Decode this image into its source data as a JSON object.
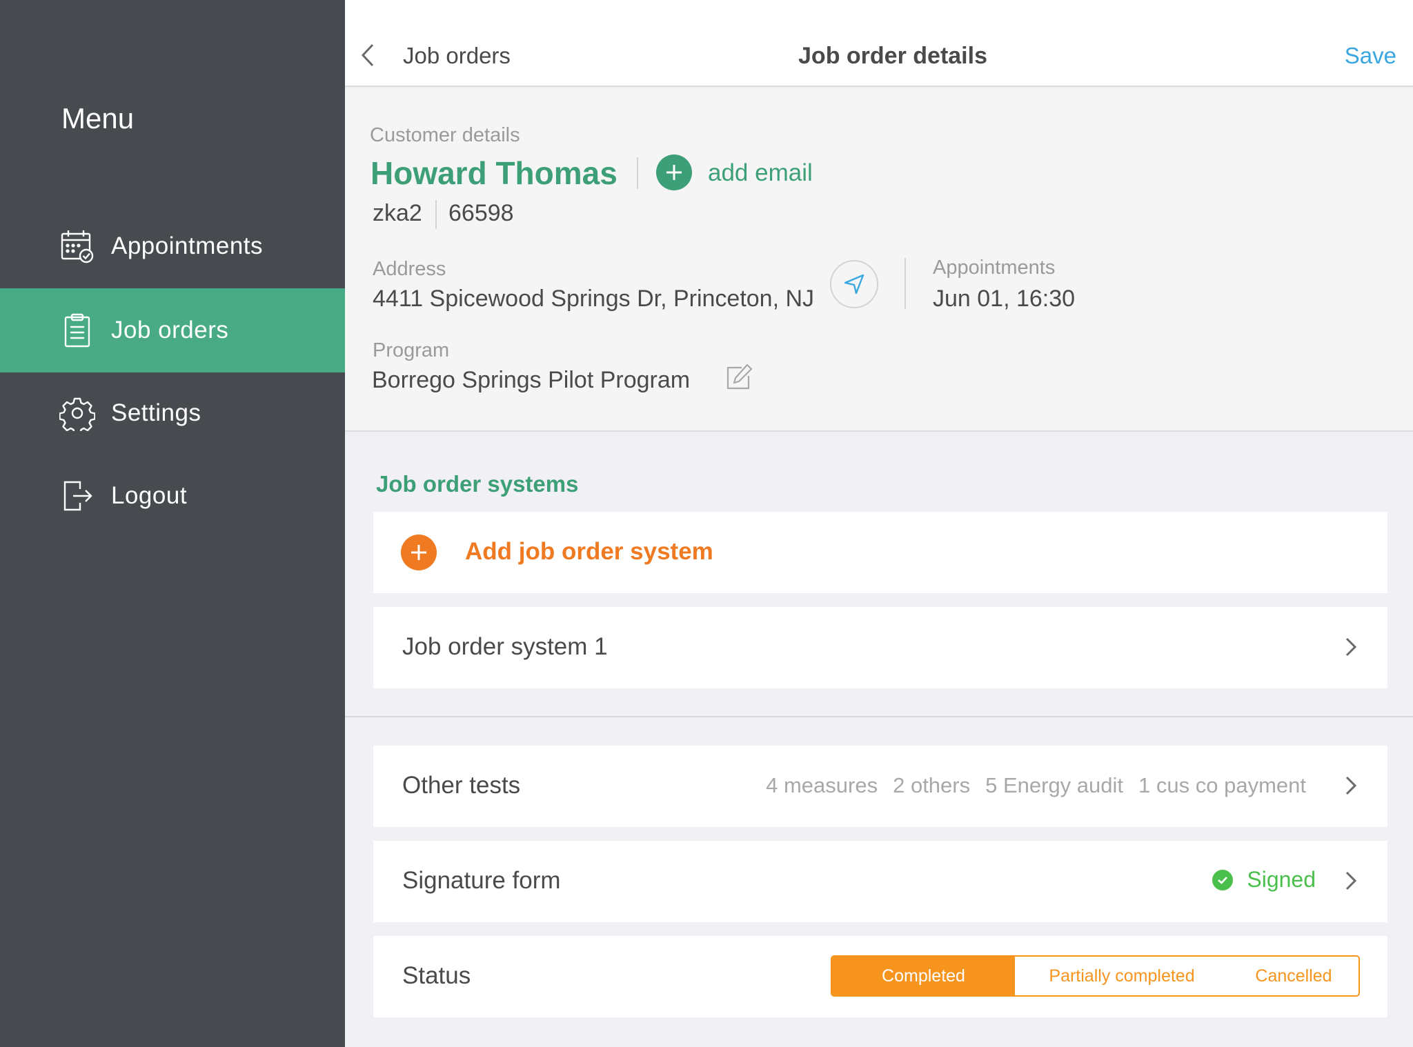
{
  "sidebar": {
    "title": "Menu",
    "items": [
      {
        "label": "Appointments",
        "icon": "calendar-check-icon",
        "active": false
      },
      {
        "label": "Job orders",
        "icon": "clipboard-icon",
        "active": true
      },
      {
        "label": "Settings",
        "icon": "gear-icon",
        "active": false
      },
      {
        "label": "Logout",
        "icon": "logout-icon",
        "active": false
      }
    ]
  },
  "header": {
    "back_label": "Job orders",
    "title": "Job order details",
    "save_label": "Save"
  },
  "customer": {
    "section_label": "Customer details",
    "name": "Howard Thomas",
    "add_email_label": "add email",
    "code": "zka2",
    "number": "66598",
    "address_label": "Address",
    "address": "4411 Spicewood Springs Dr, Princeton, NJ",
    "appointments_label": "Appointments",
    "appointment_time": "Jun 01, 16:30",
    "program_label": "Program",
    "program": "Borrego Springs Pilot Program"
  },
  "systems": {
    "section_title": "Job order systems",
    "add_label": "Add job order system",
    "items": [
      {
        "label": "Job order system 1"
      }
    ]
  },
  "other_tests": {
    "label": "Other tests",
    "tags": [
      "4 measures",
      "2 others",
      "5 Energy audit",
      "1 cus co payment"
    ]
  },
  "signature": {
    "label": "Signature form",
    "status": "Signed"
  },
  "status": {
    "label": "Status",
    "options": [
      "Completed",
      "Partially completed",
      "Cancelled"
    ],
    "selected": "Completed"
  },
  "colors": {
    "sidebar_bg": "#474a4f",
    "accent_green": "#48ab86",
    "orange": "#f07a22",
    "segment_orange": "#f7941d",
    "save_blue": "#3aa6df",
    "signed_green": "#4bbf4b"
  }
}
